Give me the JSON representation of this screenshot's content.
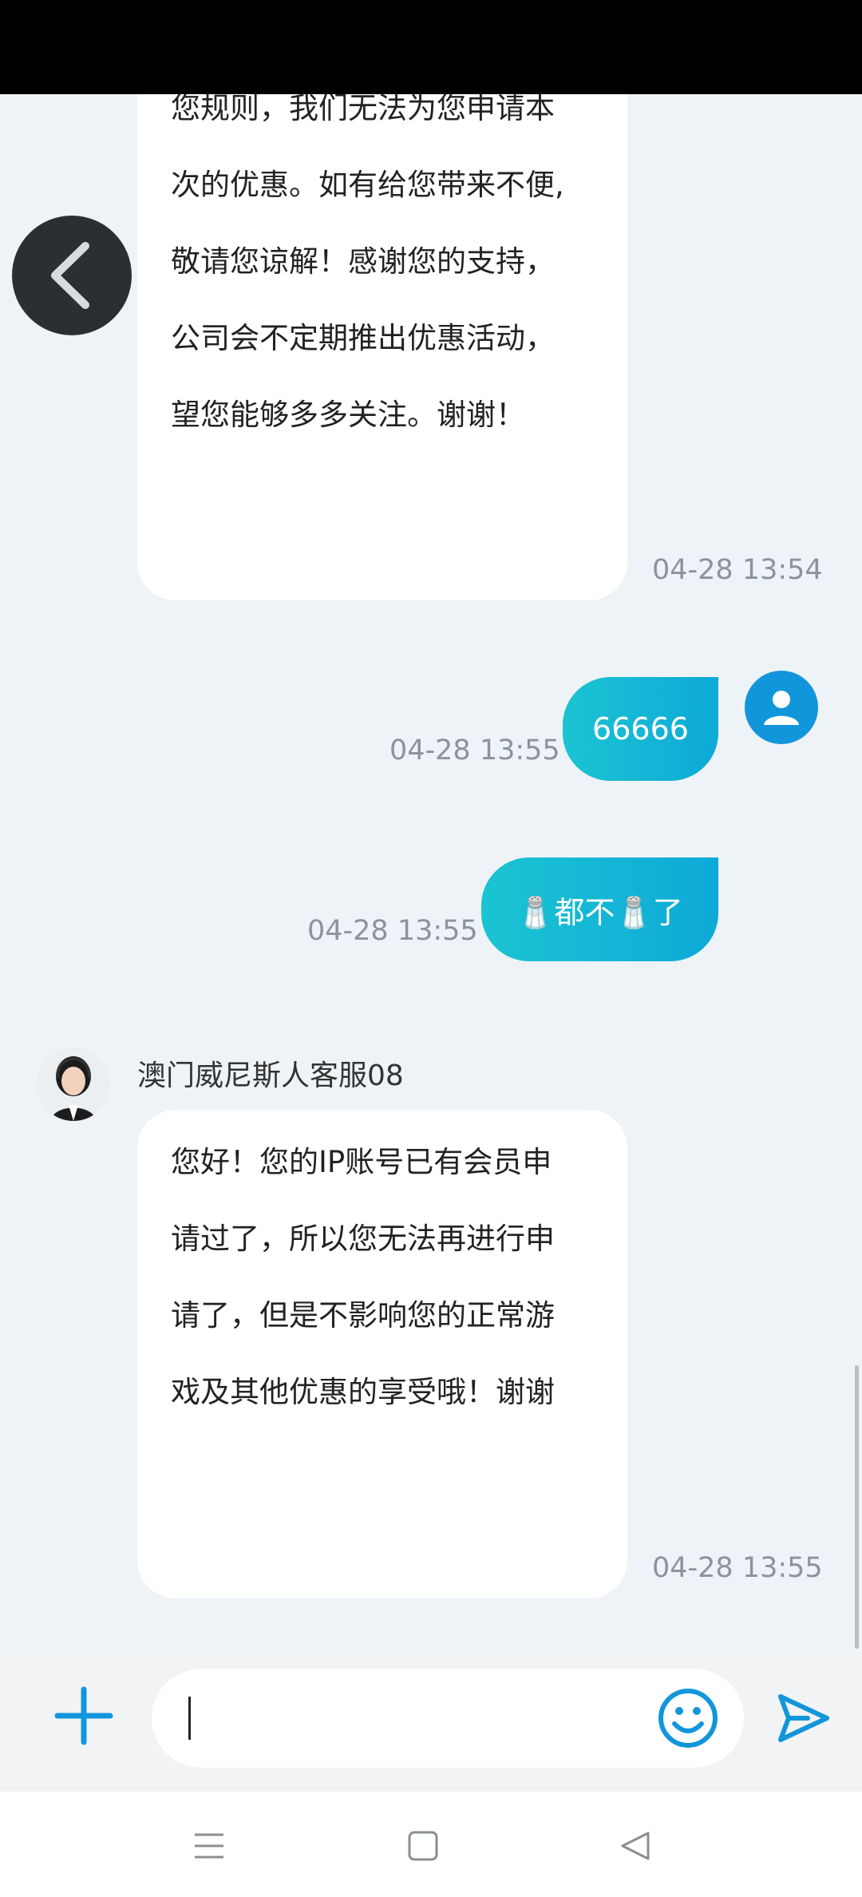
{
  "messages": {
    "first": {
      "lines": [
        "您规则，我们无法为您申请本",
        "次的优惠。如有给您带来不便,",
        "敬请您谅解！感谢您的支持，",
        "公司会不定期推出优惠活动，",
        "望您能够多多关注。谢谢！"
      ],
      "time": "04-28 13:54"
    },
    "user1": {
      "text": "66666",
      "time": "04-28 13:55"
    },
    "user2": {
      "text": "🧂都不🧂了",
      "time": "04-28 13:55"
    },
    "agent": {
      "name": "澳门威尼斯人客服08",
      "lines": [
        "您好！您的IP账号已有会员申",
        "请过了，所以您无法再进行申",
        "请了，但是不影响您的正常游",
        "戏及其他优惠的享受哦！谢谢"
      ],
      "time": "04-28 13:55"
    }
  },
  "composer": {
    "value": ""
  },
  "colors": {
    "accent": "#1296db",
    "bubble_gradient_start": "#1bc4d2",
    "bubble_gradient_end": "#0ea9d8"
  },
  "icons": [
    "chevron-left-icon",
    "user-icon",
    "plus-icon",
    "emoji-icon",
    "send-icon",
    "menu-icon",
    "home-square-icon",
    "back-triangle-icon"
  ]
}
